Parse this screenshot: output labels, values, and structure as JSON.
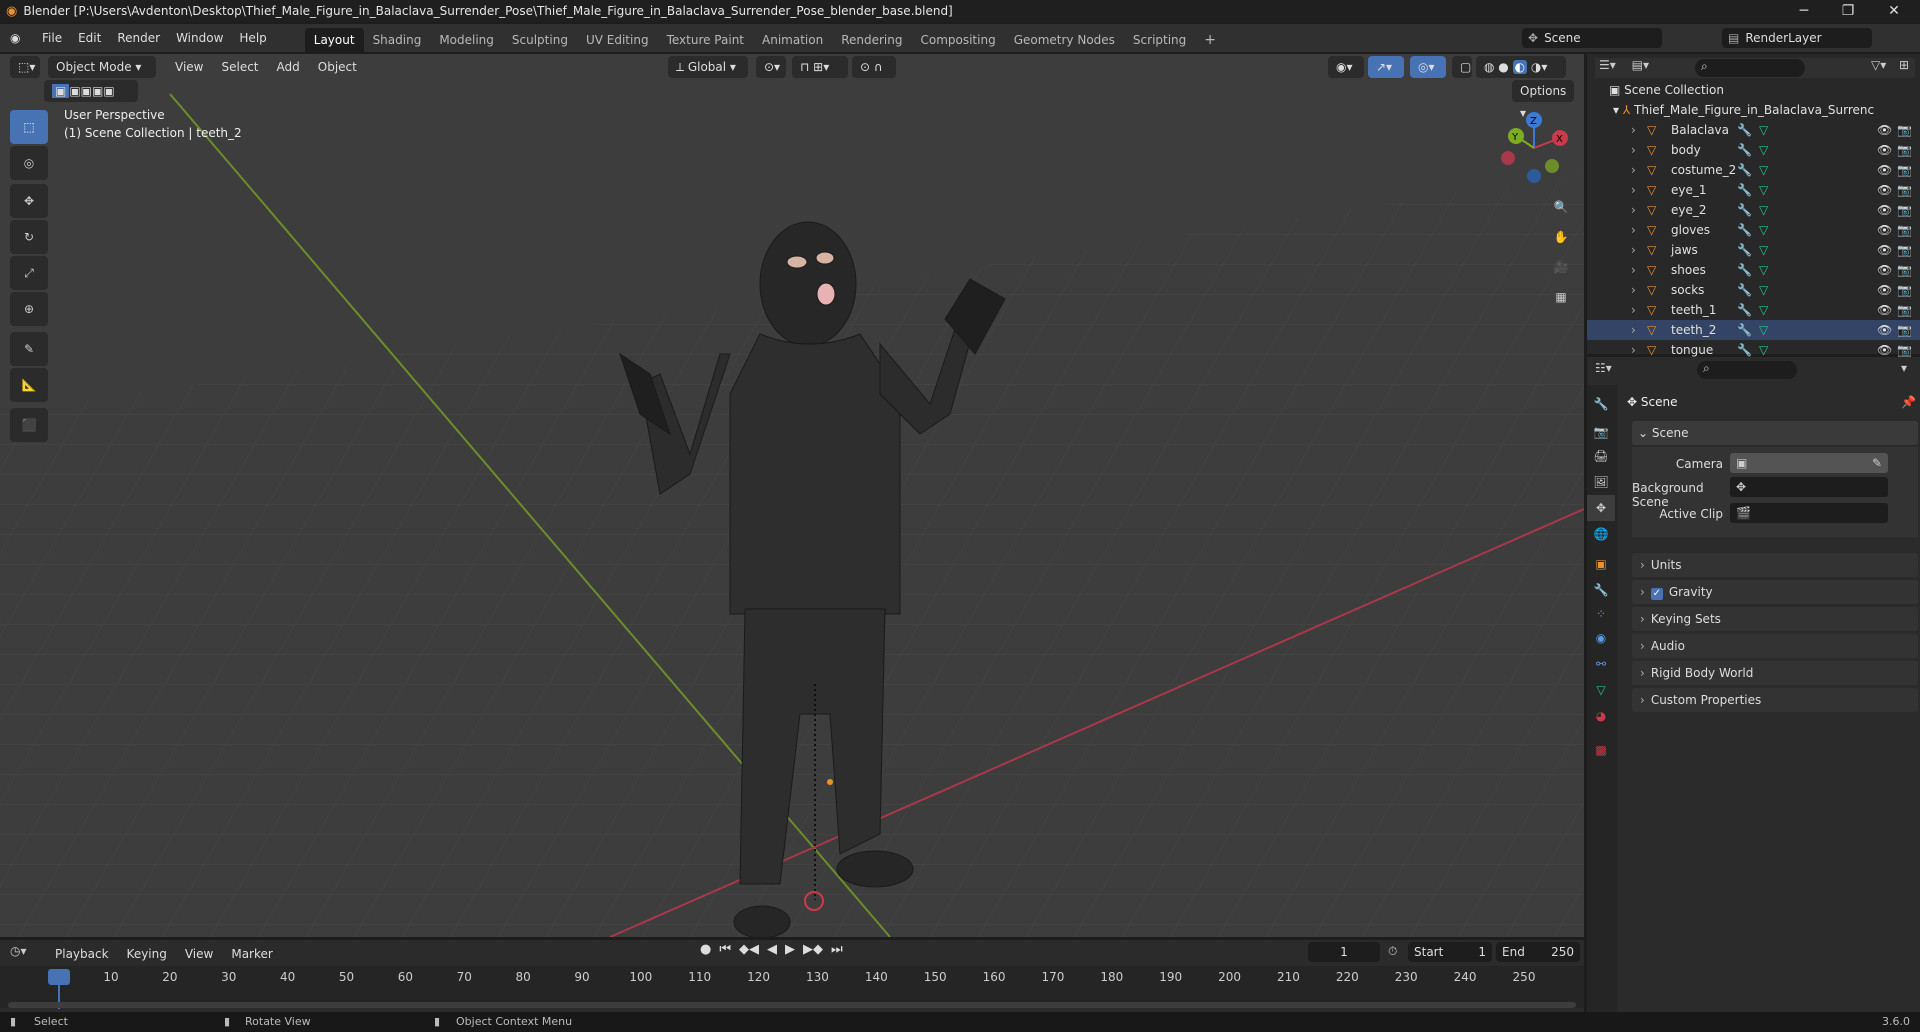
{
  "window": {
    "title": "Blender [P:\\Users\\Avdenton\\Desktop\\Thief_Male_Figure_in_Balaclava_Surrender_Pose\\Thief_Male_Figure_in_Balaclava_Surrender_Pose_blender_base.blend]",
    "minimize": "─",
    "maximize": "❐",
    "close": "✕"
  },
  "menus": [
    "File",
    "Edit",
    "Render",
    "Window",
    "Help"
  ],
  "workspaces": [
    "Layout",
    "Shading",
    "Modeling",
    "Sculpting",
    "UV Editing",
    "Texture Paint",
    "Animation",
    "Rendering",
    "Compositing",
    "Geometry Nodes",
    "Scripting"
  ],
  "add_workspace": "+",
  "scene_name": "Scene",
  "view_layer": "RenderLayer",
  "viewport": {
    "mode": "Object Mode",
    "menus": [
      "View",
      "Select",
      "Add",
      "Object"
    ],
    "orientation": "Global",
    "options": "Options",
    "perspective_label": "User Perspective",
    "collection_label": "(1) Scene Collection | teeth_2",
    "axis_x": "X",
    "axis_y": "Y",
    "axis_z": "Z"
  },
  "outliner": {
    "root": "Scene Collection",
    "object": "Thief_Male_Figure_in_Balaclava_Surrenc",
    "children": [
      "Balaclava",
      "body",
      "costume_2",
      "eye_1",
      "eye_2",
      "gloves",
      "jaws",
      "shoes",
      "socks",
      "teeth_1",
      "teeth_2",
      "tongue"
    ]
  },
  "properties": {
    "context": "Scene",
    "panel_title": "Scene",
    "camera_label": "Camera",
    "bg_scene_label": "Background Scene",
    "active_clip_label": "Active Clip",
    "sections": [
      "Units",
      "Gravity",
      "Keying Sets",
      "Audio",
      "Rigid Body World",
      "Custom Properties"
    ],
    "gravity_checked": true
  },
  "timeline": {
    "menus": [
      "Playback",
      "Keying",
      "View",
      "Marker"
    ],
    "current_frame": "1",
    "start_label": "Start",
    "start": "1",
    "end_label": "End",
    "end": "250",
    "ticks": [
      "1",
      "10",
      "20",
      "30",
      "40",
      "50",
      "60",
      "70",
      "80",
      "90",
      "100",
      "110",
      "120",
      "130",
      "140",
      "150",
      "160",
      "170",
      "180",
      "190",
      "200",
      "210",
      "220",
      "230",
      "240",
      "250"
    ]
  },
  "status": {
    "select": "Select",
    "rotate": "Rotate View",
    "context_menu": "Object Context Menu",
    "version": "3.6.0"
  },
  "colors": {
    "accent": "#4772b3",
    "x_axis": "#c93b4b",
    "y_axis": "#7cac1f",
    "z_axis": "#3a7bd5",
    "mesh_orange": "#e7912f",
    "wrench_blue": "#5a9de6",
    "mesh_green": "#1fc48a"
  }
}
